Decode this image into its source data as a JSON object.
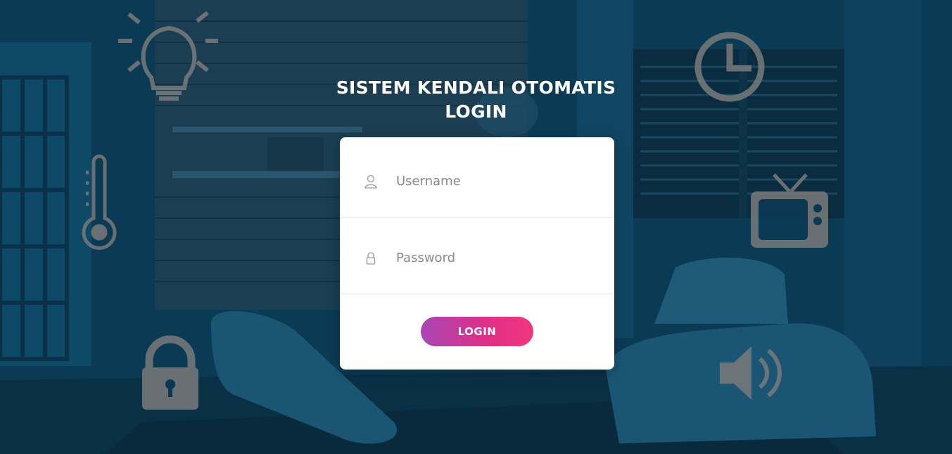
{
  "header": {
    "title_line1": "SISTEM KENDALI OTOMATIS",
    "title_line2": "LOGIN"
  },
  "form": {
    "username_placeholder": "Username",
    "username_value": "",
    "password_placeholder": "Password",
    "password_value": "",
    "login_label": "LOGIN"
  },
  "icons": {
    "user": "user-icon",
    "lock": "lock-icon"
  },
  "background_icons": [
    "lightbulb-icon",
    "thermometer-icon",
    "padlock-icon",
    "clock-icon",
    "tv-icon",
    "speaker-icon"
  ],
  "colors": {
    "background": "#0d4460",
    "card": "#ffffff",
    "button_start": "#a846b4",
    "button_end": "#f2367f",
    "icon_overlay": "#7a7a7a"
  }
}
